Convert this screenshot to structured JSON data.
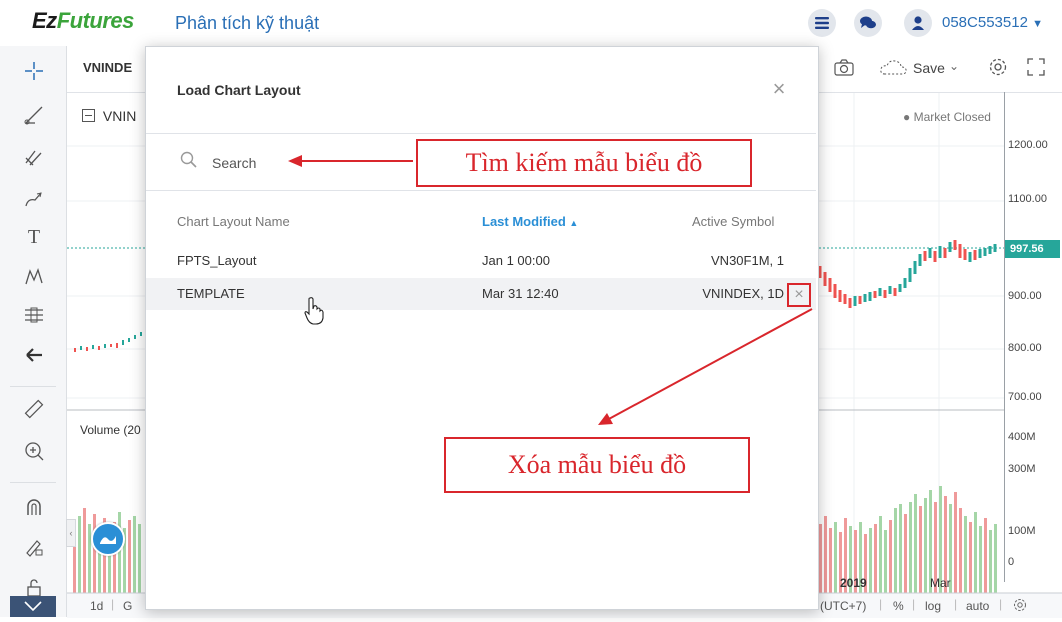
{
  "header": {
    "logo_part1": "Ez",
    "logo_part2": "Futures",
    "page_title": "Phân tích kỹ thuật",
    "user_id": "058C553512"
  },
  "chart": {
    "symbol_label": "VNINDE",
    "series_label": "VNIN",
    "market_status": "Market Closed",
    "volume_label": "Volume (20",
    "save_label": "Save",
    "current_price": "997.56",
    "price_ticks": [
      "1200.00",
      "1100.00",
      "900.00",
      "800.00",
      "700.00"
    ],
    "volume_ticks": [
      "400M",
      "300M",
      "100M",
      "0"
    ],
    "time_labels": [
      "2019",
      "Mar"
    ],
    "bottom_bar": {
      "interval": "1d",
      "interval2": "G",
      "timezone": "(UTC+7)",
      "percent": "%",
      "log": "log",
      "auto": "auto"
    },
    "colors": {
      "up": "#26a69a",
      "down": "#ef5350",
      "accent": "#2a6fb6"
    }
  },
  "dialog": {
    "title": "Load Chart Layout",
    "search_placeholder": "Search",
    "columns": {
      "name": "Chart Layout Name",
      "modified": "Last Modified",
      "symbol": "Active Symbol"
    },
    "rows": [
      {
        "name": "FPTS_Layout",
        "modified": "Jan 1 00:00",
        "symbol": "VN30F1M, 1"
      },
      {
        "name": "TEMPLATE",
        "modified": "Mar 31 12:40",
        "symbol": "VNINDEX, 1D"
      }
    ]
  },
  "annotations": {
    "search_note": "Tìm kiếm mẫu biểu đồ",
    "delete_note": "Xóa mẫu biểu đồ"
  }
}
